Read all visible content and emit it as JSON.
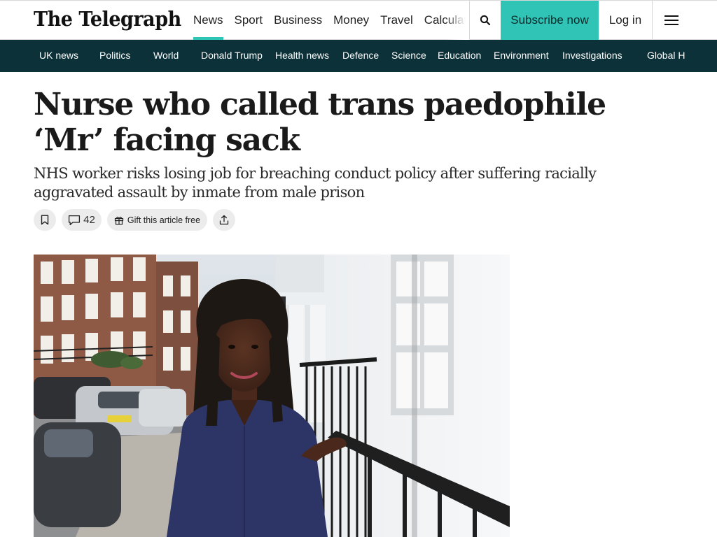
{
  "header": {
    "logo": "The Telegraph",
    "nav": [
      {
        "label": "News",
        "active": true
      },
      {
        "label": "Sport",
        "active": false
      },
      {
        "label": "Business",
        "active": false
      },
      {
        "label": "Money",
        "active": false
      },
      {
        "label": "Travel",
        "active": false
      },
      {
        "label": "Calculators",
        "active": false
      }
    ],
    "search_icon": "search-icon",
    "subscribe_label": "Subscribe now",
    "login_label": "Log in",
    "menu_icon": "hamburger-menu-icon"
  },
  "subnav": {
    "items": [
      "UK news",
      "Politics",
      "World",
      "Donald Trump",
      "Health news",
      "Defence",
      "Science",
      "Education",
      "Environment",
      "Investigations",
      "Global H"
    ]
  },
  "article": {
    "headline": "Nurse who called trans paedophile ‘Mr’ facing sack",
    "standfirst": "NHS worker risks losing job for breaching conduct policy after suffering racially aggravated assault by inmate from male prison",
    "actions": {
      "save_icon": "bookmark-icon",
      "comments_icon": "comment-icon",
      "comments_count": "42",
      "gift_icon": "gift-icon",
      "gift_label": "Gift this article free",
      "share_icon": "share-icon"
    }
  },
  "colors": {
    "accent": "#2fc4b6",
    "subnav_bg": "#0c3138",
    "pill_bg": "#ececec"
  }
}
